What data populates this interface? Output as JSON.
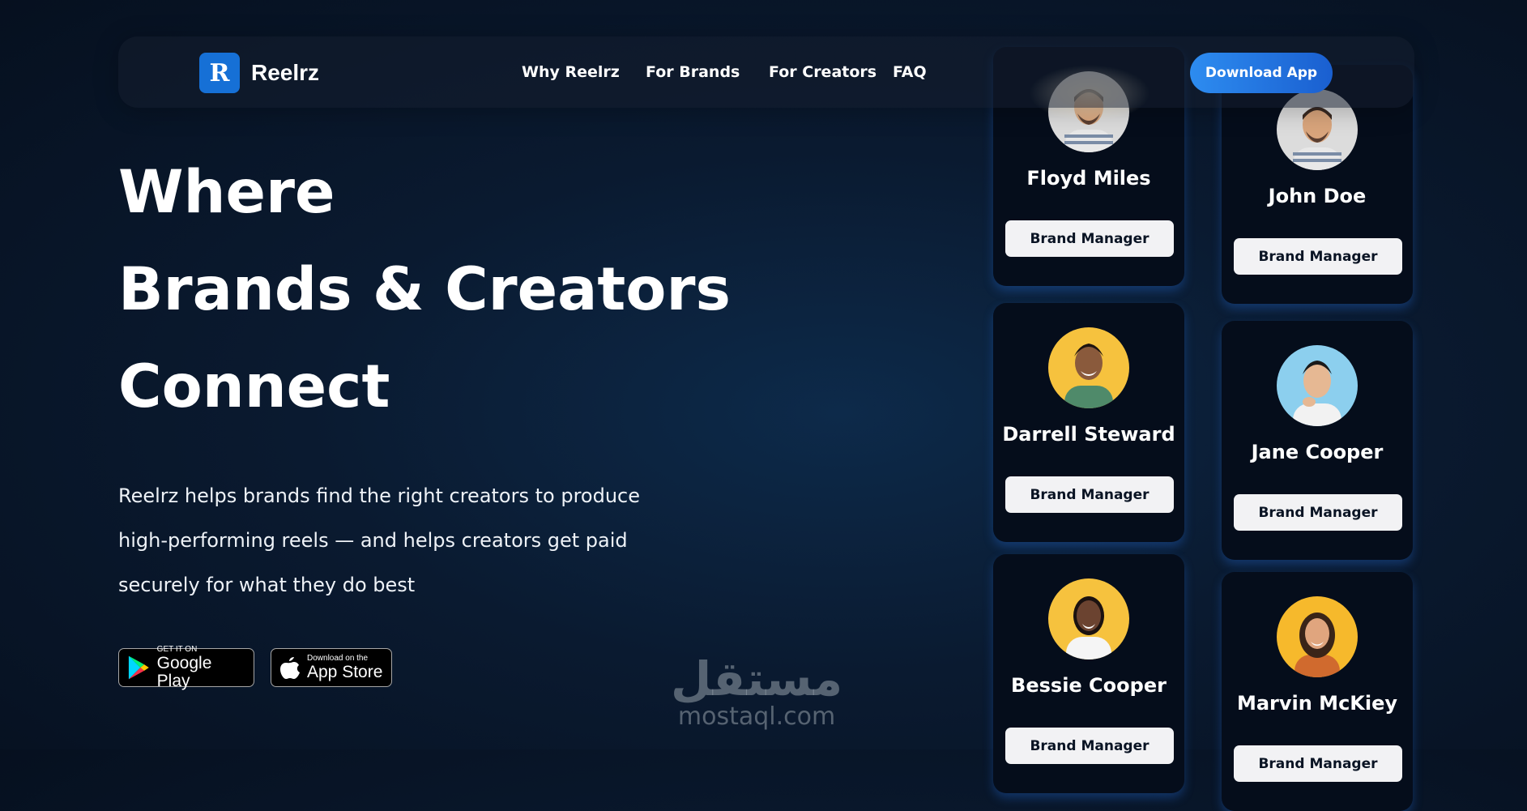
{
  "brand": {
    "logo_letter": "R",
    "name": "Reelrz"
  },
  "nav": {
    "links": [
      "Why Reelrz",
      "For Brands",
      "For Creators",
      "FAQ"
    ],
    "cta": "Download App"
  },
  "hero": {
    "title_lines": [
      "Where",
      "Brands & Creators",
      "Connect"
    ],
    "description": "Reelrz helps brands find the right creators to produce high-performing reels — and helps creators get paid securely for what they do best"
  },
  "stores": {
    "google": {
      "small": "GET IT ON",
      "big": "Google Play"
    },
    "apple": {
      "small": "Download on the",
      "big": "App Store"
    }
  },
  "watermark": {
    "arabic": "مستقل",
    "latin": "mostaql.com"
  },
  "cards": [
    {
      "name": "Floyd Miles",
      "role": "Brand Manager",
      "avatar_bg": "#dcdcdc",
      "avatar_icon": "man-avatar-icon"
    },
    {
      "name": "John Doe",
      "role": "Brand Manager",
      "avatar_bg": "#dcdcdc",
      "avatar_icon": "man-avatar-icon"
    },
    {
      "name": "Darrell Steward",
      "role": "Brand Manager",
      "avatar_bg": "#f6c23e",
      "avatar_icon": "man-avatar-icon"
    },
    {
      "name": "Jane Cooper",
      "role": "Brand Manager",
      "avatar_bg": "#8ccfee",
      "avatar_icon": "man-avatar-icon"
    },
    {
      "name": "Bessie Cooper",
      "role": "Brand Manager",
      "avatar_bg": "#f6c23e",
      "avatar_icon": "woman-avatar-icon"
    },
    {
      "name": "Marvin McKiey",
      "role": "Brand Manager",
      "avatar_bg": "#f6b92c",
      "avatar_icon": "woman-avatar-icon"
    }
  ],
  "colors": {
    "accent": "#2d8cf0",
    "background": "#0a1a30",
    "card": "#050d1b"
  }
}
